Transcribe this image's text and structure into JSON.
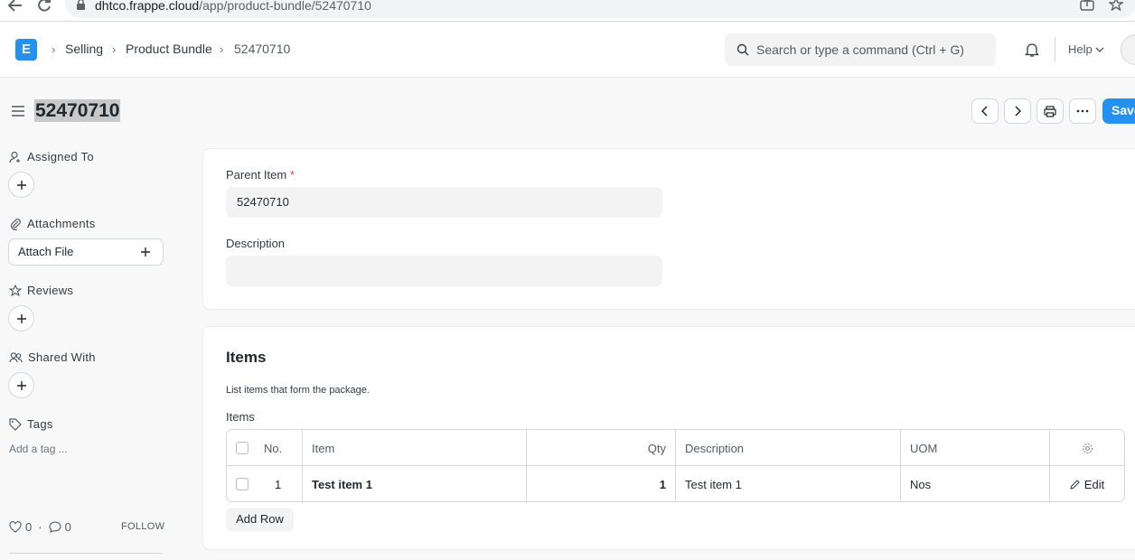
{
  "browser": {
    "url_host": "dhtco.frappe.cloud",
    "url_path": "/app/product-bundle/52470710"
  },
  "navbar": {
    "logo_letter": "E",
    "breadcrumbs": [
      "Selling",
      "Product Bundle",
      "52470710"
    ],
    "search_placeholder": "Search or type a command (Ctrl + G)",
    "help_label": "Help"
  },
  "page": {
    "title": "52470710",
    "save_label": "Save"
  },
  "sidebar": {
    "assigned_to": "Assigned To",
    "attachments": "Attachments",
    "attach_file": "Attach File",
    "reviews": "Reviews",
    "shared_with": "Shared With",
    "tags": "Tags",
    "add_tag": "Add a tag ...",
    "likes_count": "0",
    "dot": "·",
    "comments_count": "0",
    "follow": "FOLLOW"
  },
  "form": {
    "parent_item_label": "Parent Item",
    "required_mark": "*",
    "parent_item_value": "52470710",
    "description_label": "Description",
    "description_value": ""
  },
  "items_section": {
    "title": "Items",
    "description": "List items that form the package.",
    "table_label": "Items",
    "columns": {
      "no": "No.",
      "item": "Item",
      "qty": "Qty",
      "description": "Description",
      "uom": "UOM"
    },
    "rows": [
      {
        "no": "1",
        "item": "Test item 1",
        "qty": "1",
        "description": "Test item 1",
        "uom": "Nos",
        "edit": "Edit"
      }
    ],
    "add_row": "Add Row"
  },
  "colors": {
    "primary": "#2490ef",
    "required": "#e24c4c"
  }
}
